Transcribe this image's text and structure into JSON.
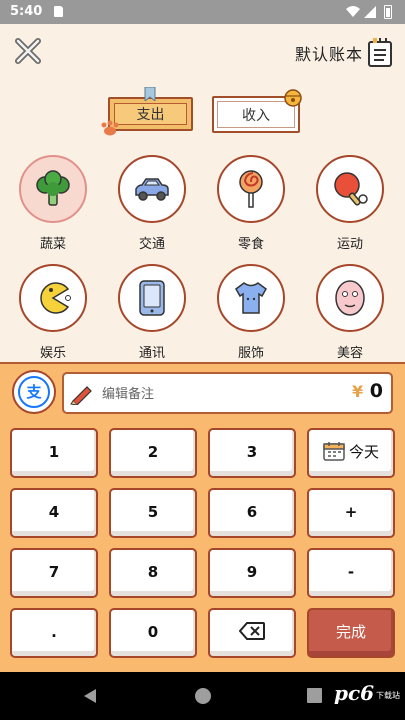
{
  "status_bar": {
    "time": "5:40"
  },
  "header": {
    "book_title": "默认账本"
  },
  "tabs": {
    "expense": "支出",
    "income": "收入"
  },
  "categories": [
    {
      "label": "蔬菜",
      "icon": "broccoli-icon",
      "selected": true
    },
    {
      "label": "交通",
      "icon": "car-icon",
      "selected": false
    },
    {
      "label": "零食",
      "icon": "lollipop-icon",
      "selected": false
    },
    {
      "label": "运动",
      "icon": "ping-pong-icon",
      "selected": false
    },
    {
      "label": "娱乐",
      "icon": "pacman-icon",
      "selected": false
    },
    {
      "label": "通讯",
      "icon": "phone-icon",
      "selected": false
    },
    {
      "label": "服饰",
      "icon": "tshirt-icon",
      "selected": false
    },
    {
      "label": "美容",
      "icon": "face-mask-icon",
      "selected": false
    }
  ],
  "payment": {
    "icon_label": "支"
  },
  "note": {
    "placeholder": "编辑备注",
    "currency": "¥",
    "amount": "0"
  },
  "keypad": {
    "k1": "1",
    "k2": "2",
    "k3": "3",
    "today": "今天",
    "k4": "4",
    "k5": "5",
    "k6": "6",
    "plus": "+",
    "k7": "7",
    "k8": "8",
    "k9": "9",
    "minus": "-",
    "dot": ".",
    "k0": "0",
    "done": "完成"
  },
  "watermark": {
    "main": "pc6",
    "sub": "下载站"
  },
  "colors": {
    "accent": "#a6462a",
    "panel": "#f9ba6f",
    "done": "#c55b4a",
    "background": "#faf1e4"
  }
}
